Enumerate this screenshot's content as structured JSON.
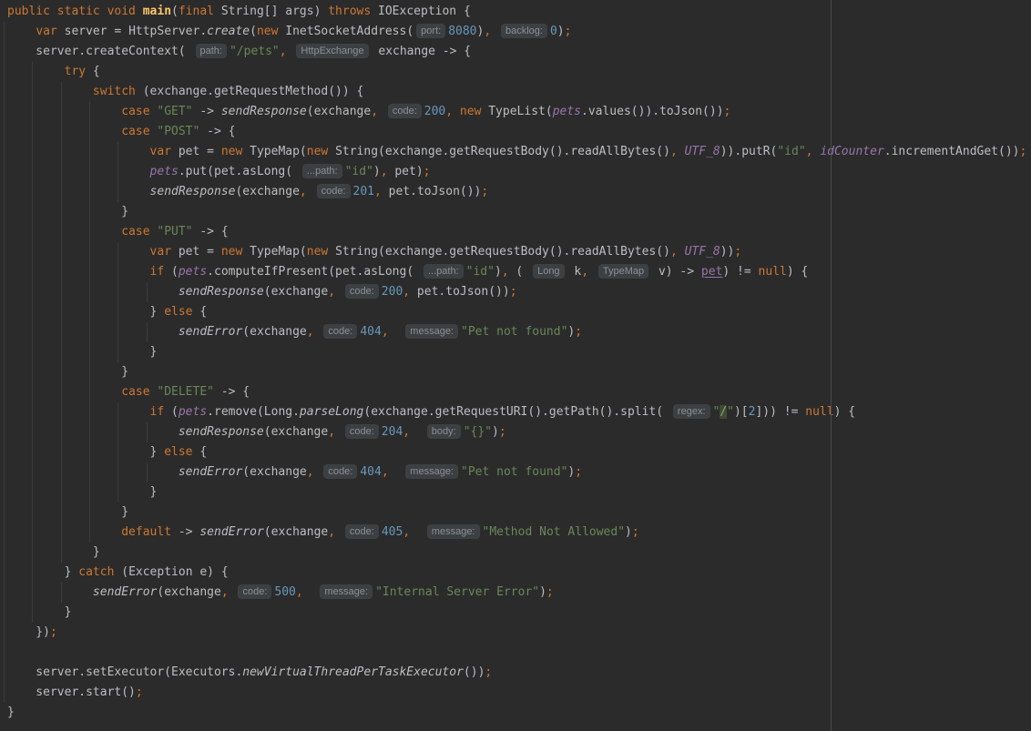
{
  "editor": {
    "type": "ide-code-editor",
    "language": "java",
    "colors": {
      "background": "#2b2b2b",
      "default_text": "#bcbec4",
      "keyword": "#cc7832",
      "method_declaration": "#ffc66d",
      "string": "#6a8759",
      "number": "#6897bb",
      "field": "#9876aa",
      "inlay_hint_bg": "#3d4043",
      "inlay_hint_fg": "#8c9096",
      "indent_guide": "#3b3c3e",
      "right_margin_line": "#47484a"
    },
    "right_margin_x": 912,
    "lines": [
      {
        "g": 0,
        "tok": [
          [
            "public static void ",
            "k"
          ],
          [
            "main",
            "d"
          ],
          [
            "(",
            "t"
          ],
          [
            "final",
            "k"
          ],
          [
            " String[] args) ",
            "t"
          ],
          [
            "throws",
            "k"
          ],
          [
            " IOException {",
            "t"
          ]
        ]
      },
      {
        "g": 1,
        "tok": [
          [
            "    ",
            "t"
          ],
          [
            "var",
            "k"
          ],
          [
            " server = HttpServer.",
            "t"
          ],
          [
            "create",
            "i"
          ],
          [
            "(",
            "t"
          ],
          [
            "new",
            "k"
          ],
          [
            " InetSocketAddress(",
            "t"
          ],
          [
            "port:",
            "h"
          ],
          [
            "8080",
            "n"
          ],
          [
            ")",
            "t"
          ],
          [
            ",",
            "k"
          ],
          [
            " ",
            "t"
          ],
          [
            "backlog:",
            "h"
          ],
          [
            "0",
            "n"
          ],
          [
            ")",
            "t"
          ],
          [
            ";",
            "k"
          ]
        ]
      },
      {
        "g": 1,
        "tok": [
          [
            "    server.createContext( ",
            "t"
          ],
          [
            "path:",
            "h"
          ],
          [
            "\"/pets\"",
            "s"
          ],
          [
            ",",
            "k"
          ],
          [
            " ",
            "t"
          ],
          [
            "HttpExchange",
            "th"
          ],
          [
            " exchange -> {",
            "t"
          ]
        ]
      },
      {
        "g": 2,
        "tok": [
          [
            "        ",
            "t"
          ],
          [
            "try",
            "k"
          ],
          [
            " {",
            "t"
          ]
        ]
      },
      {
        "g": 3,
        "tok": [
          [
            "            ",
            "t"
          ],
          [
            "switch",
            "k"
          ],
          [
            " (exchange.getRequestMethod()) {",
            "t"
          ]
        ]
      },
      {
        "g": 4,
        "tok": [
          [
            "                ",
            "t"
          ],
          [
            "case",
            "k"
          ],
          [
            " ",
            "t"
          ],
          [
            "\"GET\"",
            "s"
          ],
          [
            " -> ",
            "t"
          ],
          [
            "sendResponse",
            "i"
          ],
          [
            "(exchange",
            "t"
          ],
          [
            ",",
            "k"
          ],
          [
            " ",
            "t"
          ],
          [
            "code:",
            "h"
          ],
          [
            "200",
            "n"
          ],
          [
            ",",
            "k"
          ],
          [
            " ",
            "t"
          ],
          [
            "new",
            "k"
          ],
          [
            " TypeList(",
            "t"
          ],
          [
            "pets",
            "f"
          ],
          [
            ".values()).toJson())",
            "t"
          ],
          [
            ";",
            "k"
          ]
        ]
      },
      {
        "g": 4,
        "tok": [
          [
            "                ",
            "t"
          ],
          [
            "case",
            "k"
          ],
          [
            " ",
            "t"
          ],
          [
            "\"POST\"",
            "s"
          ],
          [
            " -> {",
            "t"
          ]
        ]
      },
      {
        "g": 5,
        "tok": [
          [
            "                    ",
            "t"
          ],
          [
            "var",
            "k"
          ],
          [
            " pet = ",
            "t"
          ],
          [
            "new",
            "k"
          ],
          [
            " TypeMap(",
            "t"
          ],
          [
            "new",
            "k"
          ],
          [
            " String(exchange.getRequestBody().readAllBytes()",
            "t"
          ],
          [
            ",",
            "k"
          ],
          [
            " ",
            "t"
          ],
          [
            "UTF_8",
            "f"
          ],
          [
            ")).putR(",
            "t"
          ],
          [
            "\"id\"",
            "s"
          ],
          [
            ",",
            "k"
          ],
          [
            " ",
            "t"
          ],
          [
            "idCounter",
            "f"
          ],
          [
            ".incrementAndGet())",
            "t"
          ],
          [
            ";",
            "k"
          ]
        ]
      },
      {
        "g": 5,
        "tok": [
          [
            "                    ",
            "t"
          ],
          [
            "pets",
            "f"
          ],
          [
            ".put(pet.asLong( ",
            "t"
          ],
          [
            "...path:",
            "h"
          ],
          [
            "\"id\"",
            "s"
          ],
          [
            ")",
            "t"
          ],
          [
            ",",
            "k"
          ],
          [
            " pet)",
            "t"
          ],
          [
            ";",
            "k"
          ]
        ]
      },
      {
        "g": 5,
        "tok": [
          [
            "                    ",
            "t"
          ],
          [
            "sendResponse",
            "i"
          ],
          [
            "(exchange",
            "t"
          ],
          [
            ",",
            "k"
          ],
          [
            " ",
            "t"
          ],
          [
            "code:",
            "h"
          ],
          [
            "201",
            "n"
          ],
          [
            ",",
            "k"
          ],
          [
            " pet.toJson())",
            "t"
          ],
          [
            ";",
            "k"
          ]
        ]
      },
      {
        "g": 4,
        "tok": [
          [
            "                }",
            "t"
          ]
        ]
      },
      {
        "g": 4,
        "tok": [
          [
            "                ",
            "t"
          ],
          [
            "case",
            "k"
          ],
          [
            " ",
            "t"
          ],
          [
            "\"PUT\"",
            "s"
          ],
          [
            " -> {",
            "t"
          ]
        ]
      },
      {
        "g": 5,
        "tok": [
          [
            "                    ",
            "t"
          ],
          [
            "var",
            "k"
          ],
          [
            " pet = ",
            "t"
          ],
          [
            "new",
            "k"
          ],
          [
            " TypeMap(",
            "t"
          ],
          [
            "new",
            "k"
          ],
          [
            " String(exchange.getRequestBody().readAllBytes()",
            "t"
          ],
          [
            ",",
            "k"
          ],
          [
            " ",
            "t"
          ],
          [
            "UTF_8",
            "f"
          ],
          [
            "))",
            "t"
          ],
          [
            ";",
            "k"
          ]
        ]
      },
      {
        "g": 5,
        "tok": [
          [
            "                    ",
            "t"
          ],
          [
            "if",
            "k"
          ],
          [
            " (",
            "t"
          ],
          [
            "pets",
            "f"
          ],
          [
            ".computeIfPresent(pet.asLong( ",
            "t"
          ],
          [
            "...path:",
            "h"
          ],
          [
            "\"id\"",
            "s"
          ],
          [
            ")",
            "t"
          ],
          [
            ",",
            "k"
          ],
          [
            " ( ",
            "t"
          ],
          [
            "Long",
            "th"
          ],
          [
            " k",
            "t"
          ],
          [
            ",",
            "k"
          ],
          [
            " ",
            "t"
          ],
          [
            "TypeMap",
            "th"
          ],
          [
            " v) -> ",
            "t"
          ],
          [
            "pet",
            "fu"
          ],
          [
            ") != ",
            "t"
          ],
          [
            "null",
            "k"
          ],
          [
            ") {",
            "t"
          ]
        ]
      },
      {
        "g": 6,
        "tok": [
          [
            "                        ",
            "t"
          ],
          [
            "sendResponse",
            "i"
          ],
          [
            "(exchange",
            "t"
          ],
          [
            ",",
            "k"
          ],
          [
            " ",
            "t"
          ],
          [
            "code:",
            "h"
          ],
          [
            "200",
            "n"
          ],
          [
            ",",
            "k"
          ],
          [
            " pet.toJson())",
            "t"
          ],
          [
            ";",
            "k"
          ]
        ]
      },
      {
        "g": 5,
        "tok": [
          [
            "                    } ",
            "t"
          ],
          [
            "else",
            "k"
          ],
          [
            " {",
            "t"
          ]
        ]
      },
      {
        "g": 6,
        "tok": [
          [
            "                        ",
            "t"
          ],
          [
            "sendError",
            "i"
          ],
          [
            "(exchange",
            "t"
          ],
          [
            ",",
            "k"
          ],
          [
            " ",
            "t"
          ],
          [
            "code:",
            "h"
          ],
          [
            "404",
            "n"
          ],
          [
            ",",
            "k"
          ],
          [
            "  ",
            "t"
          ],
          [
            "message:",
            "h"
          ],
          [
            "\"Pet not found\"",
            "s"
          ],
          [
            ")",
            "t"
          ],
          [
            ";",
            "k"
          ]
        ]
      },
      {
        "g": 5,
        "tok": [
          [
            "                    }",
            "t"
          ]
        ]
      },
      {
        "g": 4,
        "tok": [
          [
            "                }",
            "t"
          ]
        ]
      },
      {
        "g": 4,
        "tok": [
          [
            "                ",
            "t"
          ],
          [
            "case",
            "k"
          ],
          [
            " ",
            "t"
          ],
          [
            "\"DELETE\"",
            "s"
          ],
          [
            " -> {",
            "t"
          ]
        ]
      },
      {
        "g": 5,
        "tok": [
          [
            "                    ",
            "t"
          ],
          [
            "if",
            "k"
          ],
          [
            " (",
            "t"
          ],
          [
            "pets",
            "f"
          ],
          [
            ".remove(Long.",
            "t"
          ],
          [
            "parseLong",
            "i"
          ],
          [
            "(exchange.getRequestURI().getPath().split( ",
            "t"
          ],
          [
            "regex:",
            "h"
          ],
          [
            "\"",
            "s"
          ],
          [
            "/",
            "sh"
          ],
          [
            "\"",
            "s"
          ],
          [
            ")[",
            "t"
          ],
          [
            "2",
            "n"
          ],
          [
            "])) != ",
            "t"
          ],
          [
            "null",
            "k"
          ],
          [
            ") {",
            "t"
          ]
        ]
      },
      {
        "g": 6,
        "tok": [
          [
            "                        ",
            "t"
          ],
          [
            "sendResponse",
            "i"
          ],
          [
            "(exchange",
            "t"
          ],
          [
            ",",
            "k"
          ],
          [
            " ",
            "t"
          ],
          [
            "code:",
            "h"
          ],
          [
            "204",
            "n"
          ],
          [
            ",",
            "k"
          ],
          [
            "  ",
            "t"
          ],
          [
            "body:",
            "h"
          ],
          [
            "\"{}\"",
            "s"
          ],
          [
            ")",
            "t"
          ],
          [
            ";",
            "k"
          ]
        ]
      },
      {
        "g": 5,
        "tok": [
          [
            "                    } ",
            "t"
          ],
          [
            "else",
            "k"
          ],
          [
            " {",
            "t"
          ]
        ]
      },
      {
        "g": 6,
        "tok": [
          [
            "                        ",
            "t"
          ],
          [
            "sendError",
            "i"
          ],
          [
            "(exchange",
            "t"
          ],
          [
            ",",
            "k"
          ],
          [
            " ",
            "t"
          ],
          [
            "code:",
            "h"
          ],
          [
            "404",
            "n"
          ],
          [
            ",",
            "k"
          ],
          [
            "  ",
            "t"
          ],
          [
            "message:",
            "h"
          ],
          [
            "\"Pet not found\"",
            "s"
          ],
          [
            ")",
            "t"
          ],
          [
            ";",
            "k"
          ]
        ]
      },
      {
        "g": 5,
        "tok": [
          [
            "                    }",
            "t"
          ]
        ]
      },
      {
        "g": 4,
        "tok": [
          [
            "                }",
            "t"
          ]
        ]
      },
      {
        "g": 4,
        "tok": [
          [
            "                ",
            "t"
          ],
          [
            "default",
            "k"
          ],
          [
            " -> ",
            "t"
          ],
          [
            "sendError",
            "i"
          ],
          [
            "(exchange",
            "t"
          ],
          [
            ",",
            "k"
          ],
          [
            " ",
            "t"
          ],
          [
            "code:",
            "h"
          ],
          [
            "405",
            "n"
          ],
          [
            ",",
            "k"
          ],
          [
            "  ",
            "t"
          ],
          [
            "message:",
            "h"
          ],
          [
            "\"Method Not Allowed\"",
            "s"
          ],
          [
            ")",
            "t"
          ],
          [
            ";",
            "k"
          ]
        ]
      },
      {
        "g": 3,
        "tok": [
          [
            "            }",
            "t"
          ]
        ]
      },
      {
        "g": 2,
        "tok": [
          [
            "        } ",
            "t"
          ],
          [
            "catch",
            "k"
          ],
          [
            " (Exception e) {",
            "t"
          ]
        ]
      },
      {
        "g": 3,
        "tok": [
          [
            "            ",
            "t"
          ],
          [
            "sendError",
            "i"
          ],
          [
            "(exchange",
            "t"
          ],
          [
            ",",
            "k"
          ],
          [
            " ",
            "t"
          ],
          [
            "code:",
            "h"
          ],
          [
            "500",
            "n"
          ],
          [
            ",",
            "k"
          ],
          [
            "  ",
            "t"
          ],
          [
            "message:",
            "h"
          ],
          [
            "\"Internal Server Error\"",
            "s"
          ],
          [
            ")",
            "t"
          ],
          [
            ";",
            "k"
          ]
        ]
      },
      {
        "g": 2,
        "tok": [
          [
            "        }",
            "t"
          ]
        ]
      },
      {
        "g": 1,
        "tok": [
          [
            "    })",
            "t"
          ],
          [
            ";",
            "k"
          ]
        ]
      },
      {
        "g": 1,
        "tok": [
          [
            "",
            "t"
          ]
        ]
      },
      {
        "g": 1,
        "tok": [
          [
            "    server.setExecutor(Executors.",
            "t"
          ],
          [
            "newVirtualThreadPerTaskExecutor",
            "i"
          ],
          [
            "())",
            "t"
          ],
          [
            ";",
            "k"
          ]
        ]
      },
      {
        "g": 1,
        "tok": [
          [
            "    server.start()",
            "t"
          ],
          [
            ";",
            "k"
          ]
        ]
      },
      {
        "g": 0,
        "tok": [
          [
            "}",
            "t"
          ]
        ]
      }
    ]
  }
}
